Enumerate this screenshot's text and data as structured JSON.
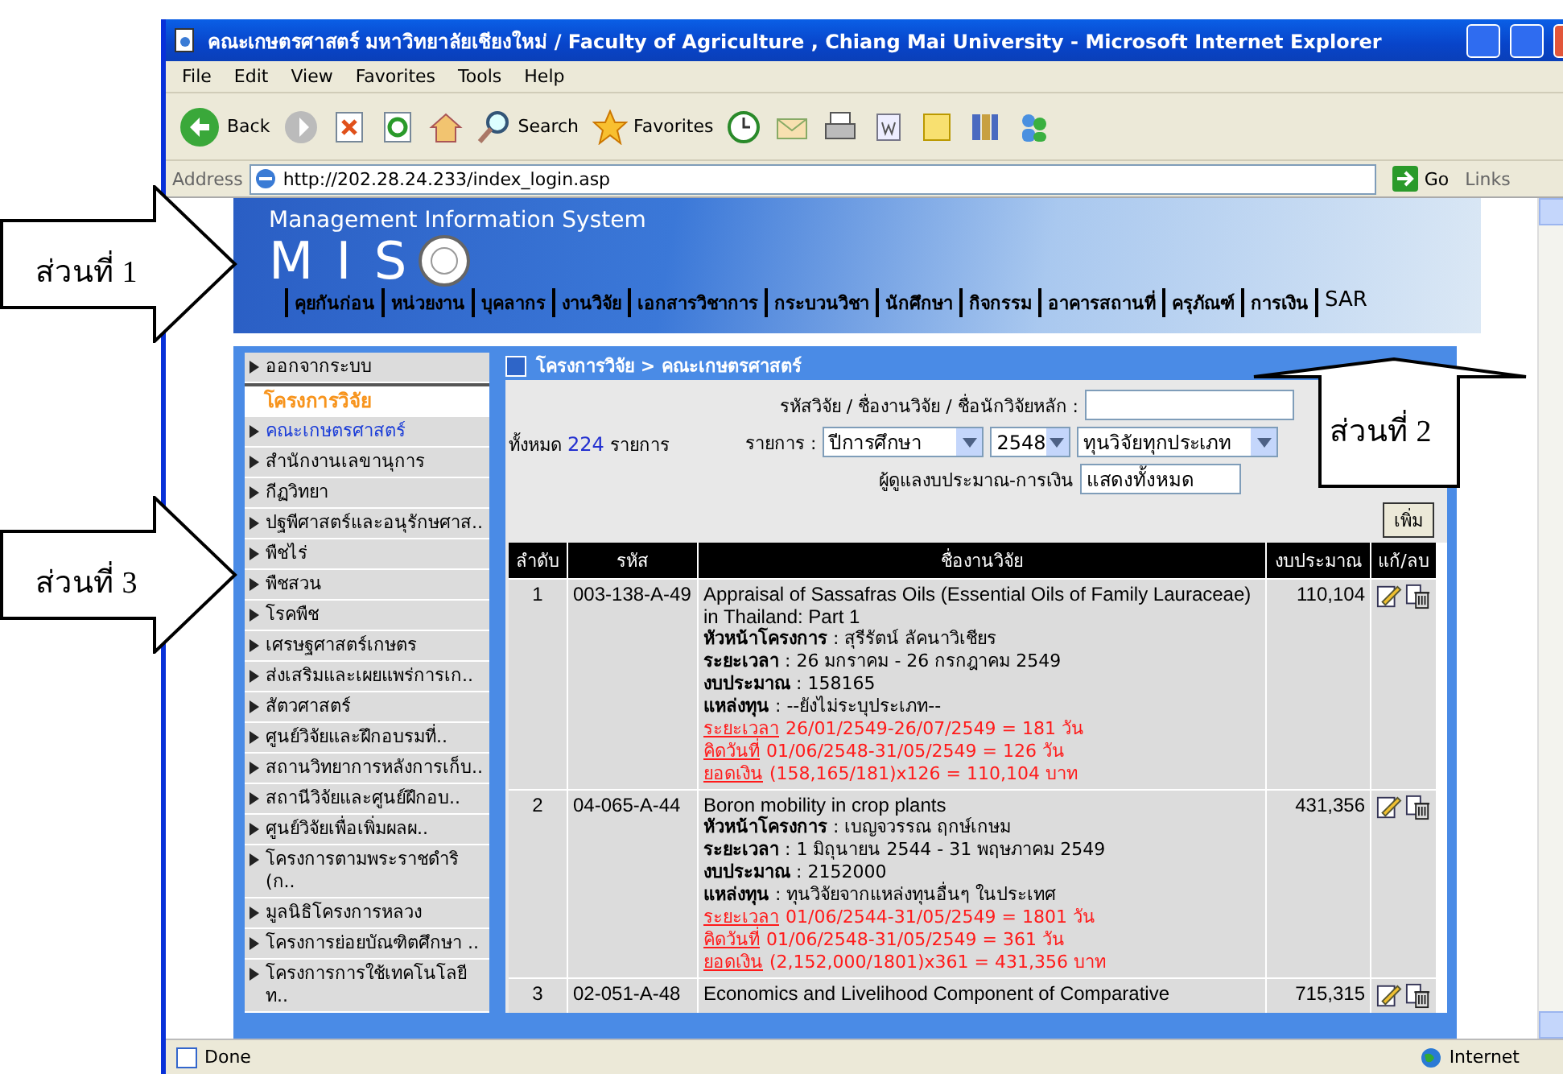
{
  "window": {
    "title": "คณะเกษตรศาสตร์ มหาวิทยาลัยเชียงใหม่ / Faculty of Agriculture , Chiang Mai University   - Microsoft Internet Explorer"
  },
  "menu": [
    "File",
    "Edit",
    "View",
    "Favorites",
    "Tools",
    "Help"
  ],
  "toolbar": {
    "back": "Back",
    "search": "Search",
    "favorites": "Favorites"
  },
  "address": {
    "label": "Address",
    "url": "http://202.28.24.233/index_login.asp",
    "go": "Go",
    "links": "Links"
  },
  "banner": {
    "subtitle": "Management Information System",
    "logo": "M I S",
    "nav": [
      "คุยกันก่อน",
      "หน่วยงาน",
      "บุคลากร",
      "งานวิจัย",
      "เอกสารวิชาการ",
      "กระบวนวิชา",
      "นักศึกษา",
      "กิจกรรม",
      "อาคารสถานที่",
      "ครุภัณฑ์",
      "การเงิน",
      "SAR"
    ]
  },
  "sidebar": {
    "items": [
      {
        "label": "ออกจากระบบ",
        "kind": "link",
        "selected": false
      },
      {
        "label": "โครงการวิจัย",
        "kind": "heading"
      },
      {
        "label": "คณะเกษตรศาสตร์",
        "kind": "link",
        "selected": true
      },
      {
        "label": "สำนักงานเลขานุการ",
        "kind": "link",
        "selected": false
      },
      {
        "label": "กีฏวิทยา",
        "kind": "link",
        "selected": false
      },
      {
        "label": "ปฐพีศาสตร์และอนุรักษศาส..",
        "kind": "link",
        "selected": false
      },
      {
        "label": "พืชไร่",
        "kind": "link",
        "selected": false
      },
      {
        "label": "พืชสวน",
        "kind": "link",
        "selected": false
      },
      {
        "label": "โรคพืช",
        "kind": "link",
        "selected": false
      },
      {
        "label": "เศรษฐศาสตร์เกษตร",
        "kind": "link",
        "selected": false
      },
      {
        "label": "ส่งเสริมและเผยแพร่การเก..",
        "kind": "link",
        "selected": false
      },
      {
        "label": "สัตวศาสตร์",
        "kind": "link",
        "selected": false
      },
      {
        "label": "ศูนย์วิจัยและฝึกอบรมที่..",
        "kind": "link",
        "selected": false
      },
      {
        "label": "สถานวิทยาการหลังการเก็บ..",
        "kind": "link",
        "selected": false
      },
      {
        "label": "สถานีวิจัยและศูนย์ฝึกอบ..",
        "kind": "link",
        "selected": false
      },
      {
        "label": "ศูนย์วิจัยเพื่อเพิ่มผลผ..",
        "kind": "link",
        "selected": false
      },
      {
        "label": "โครงการตามพระราชดำริ (ก..",
        "kind": "link",
        "selected": false
      },
      {
        "label": "มูลนิธิโครงการหลวง",
        "kind": "link",
        "selected": false
      },
      {
        "label": "โครงการย่อยบัณฑิตศึกษา ..",
        "kind": "link",
        "selected": false
      },
      {
        "label": "โครงการการใช้เทคโนโลยี ท..",
        "kind": "link",
        "selected": false
      }
    ]
  },
  "main": {
    "breadcrumb": "โครงการวิจัย > คณะเกษตรศาสตร์",
    "search_label": "รหัสวิจัย / ชื่องานวิจัย / ชื่อนักวิจัยหลัก :",
    "total_prefix": "ทั้งหมด",
    "total": "224",
    "total_suffix": "รายการ",
    "filter_label": "รายการ :",
    "selects": [
      "ปีการศึกษา",
      "2548",
      "ทุนวิจัยทุกประเภท"
    ],
    "manager_label": "ผู้ดูแลงบประมาณ-การเงิน",
    "manager_value": "แสดงทั้งหมด",
    "add_button": "เพิ่ม",
    "columns": [
      "ลำดับ",
      "รหัส",
      "ชื่องานวิจัย",
      "งบประมาณ",
      "แก้/ลบ"
    ],
    "rows": [
      {
        "no": "1",
        "code": "003-138-A-49",
        "title": "Appraisal of Sassafras Oils (Essential Oils of Family Lauraceae) in Thailand: Part 1",
        "budget": "110,104",
        "details": [
          "**หัวหน้าโครงการ** : สุรีรัตน์ ลัคนาวิเชียร",
          "**ระยะเวลา** : 26 มกราคม - 26 กรกฎาคม 2549",
          "**งบประมาณ** : 158165",
          "**แหล่งทุน** : --ยังไม่ระบุประเภท--"
        ],
        "calc": [
          {
            "label": "ระยะเวลา",
            "value": "26/01/2549-26/07/2549 = 181 วัน"
          },
          {
            "label": "คิดวันที่",
            "value": "01/06/2548-31/05/2549 = 126 วัน"
          },
          {
            "label": "ยอดเงิน",
            "value": "(158,165/181)x126 = 110,104 บาท"
          }
        ]
      },
      {
        "no": "2",
        "code": "04-065-A-44",
        "title": "Boron mobility in crop plants",
        "budget": "431,356",
        "details": [
          "**หัวหน้าโครงการ** : เบญจวรรณ ฤกษ์เกษม",
          "**ระยะเวลา** : 1 มิถุนายน 2544 - 31 พฤษภาคม 2549",
          "**งบประมาณ** : 2152000",
          "**แหล่งทุน** : ทุนวิจัยจากแหล่งทุนอื่นๆ ในประเทศ"
        ],
        "calc": [
          {
            "label": "ระยะเวลา",
            "value": "01/06/2544-31/05/2549 = 1801 วัน"
          },
          {
            "label": "คิดวันที่",
            "value": "01/06/2548-31/05/2549 = 361 วัน"
          },
          {
            "label": "ยอดเงิน",
            "value": "(2,152,000/1801)x361 = 431,356 บาท"
          }
        ]
      },
      {
        "no": "3",
        "code": "02-051-A-48",
        "title": "Economics and Livelihood Component of Comparative",
        "budget": "715,315",
        "details": [],
        "calc": []
      }
    ]
  },
  "status_bar": {
    "text": "Done",
    "zone": "Internet"
  },
  "callouts": [
    {
      "label": "ส่วนที่ 1",
      "kind": "right"
    },
    {
      "label": "ส่วนที่ 2",
      "kind": "up"
    },
    {
      "label": "ส่วนที่ 3",
      "kind": "right"
    }
  ]
}
